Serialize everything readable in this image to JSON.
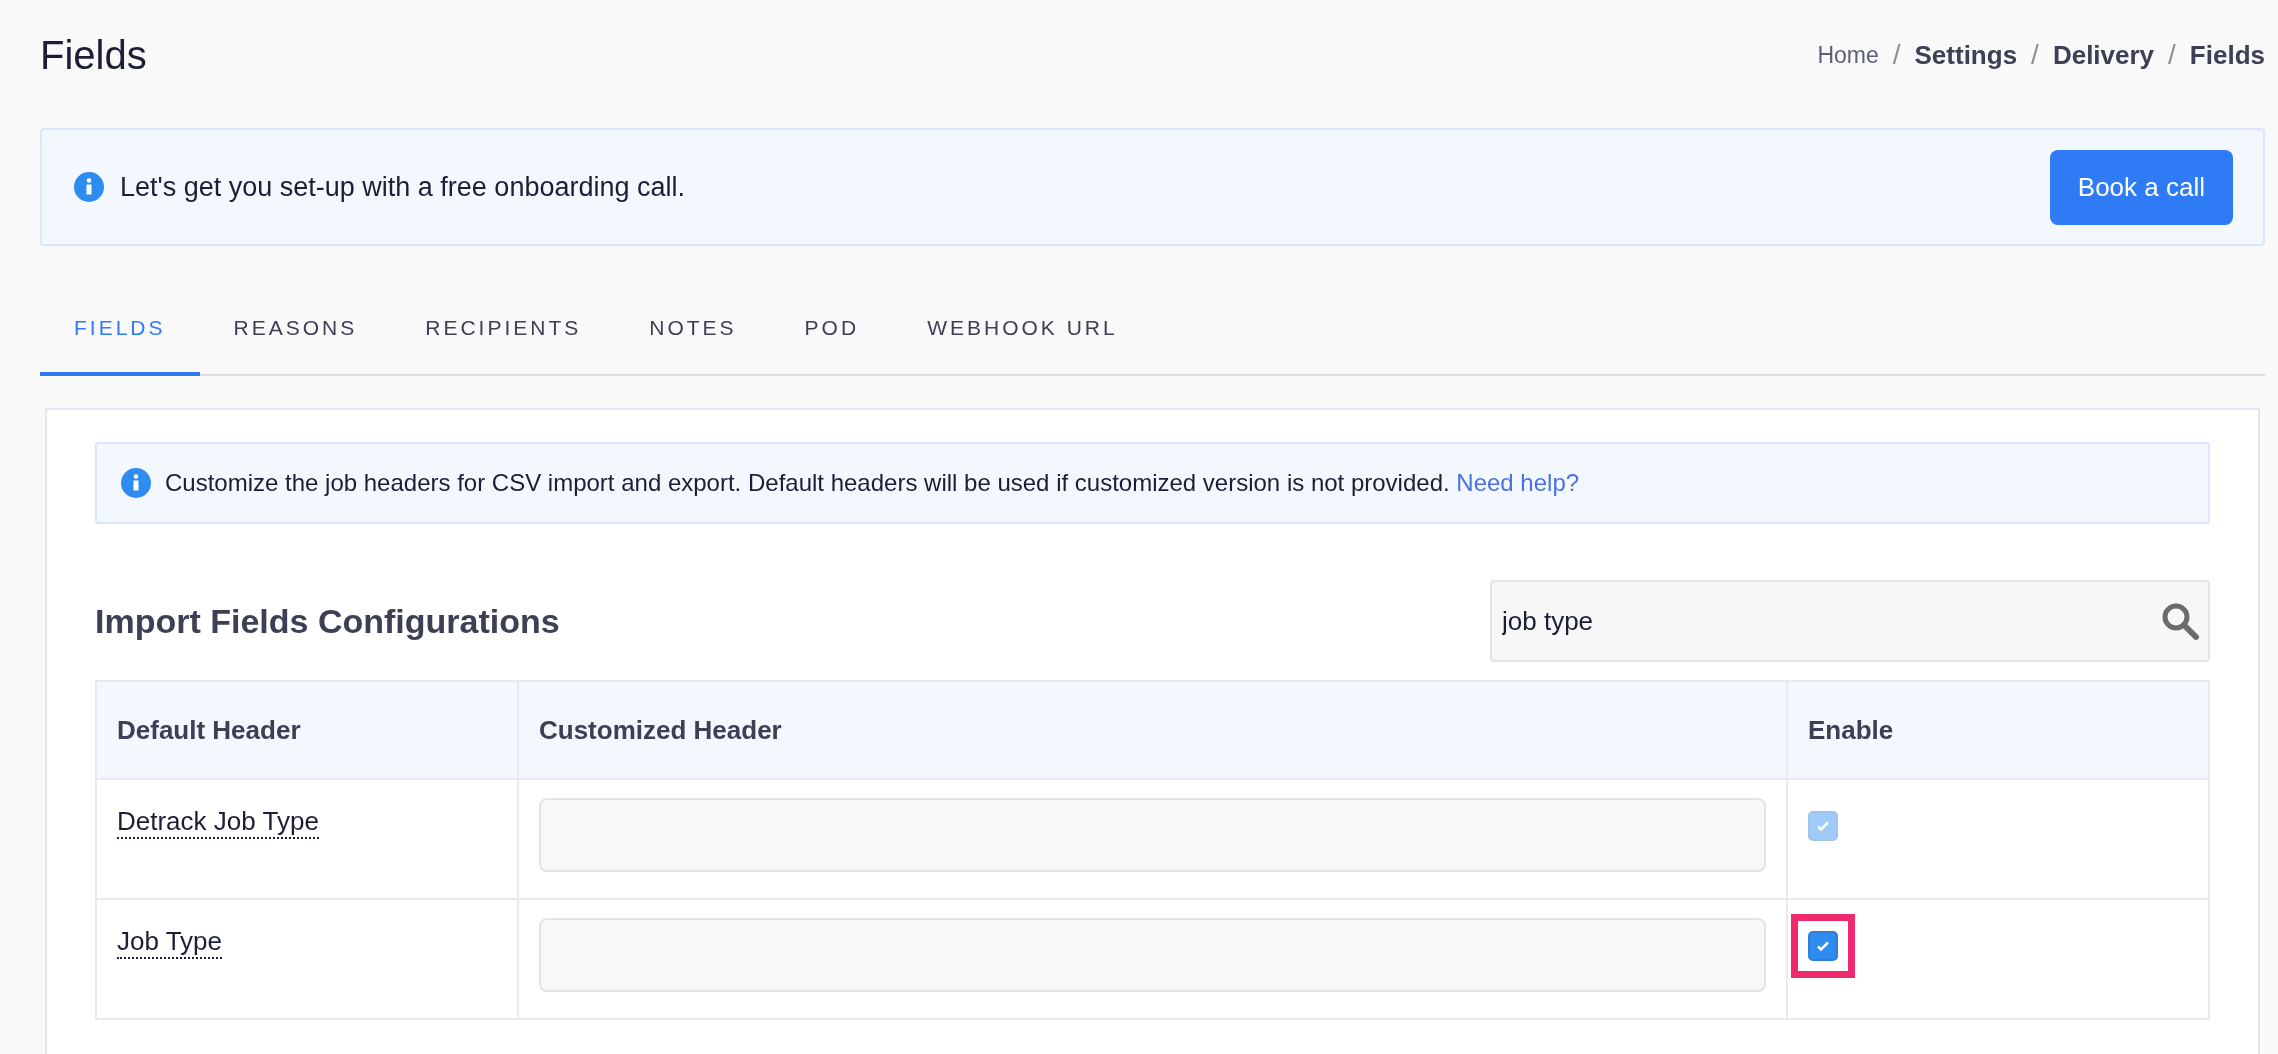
{
  "page": {
    "title": "Fields"
  },
  "breadcrumbs": [
    {
      "label": "Home",
      "current": false
    },
    {
      "label": "Settings",
      "current": true
    },
    {
      "label": "Delivery",
      "current": true
    },
    {
      "label": "Fields",
      "current": true
    }
  ],
  "breadcrumb_separator": "/",
  "banner": {
    "text": "Let's get you set-up with a free onboarding call.",
    "button": "Book a call"
  },
  "tabs": [
    {
      "label": "FIELDS",
      "selected": true
    },
    {
      "label": "REASONS",
      "selected": false
    },
    {
      "label": "RECIPIENTS",
      "selected": false
    },
    {
      "label": "NOTES",
      "selected": false
    },
    {
      "label": "POD",
      "selected": false
    },
    {
      "label": "WEBHOOK URL",
      "selected": false
    }
  ],
  "info": {
    "text": "Customize the job headers for CSV import and export. Default headers will be used if customized version is not provided.",
    "link": "Need help?"
  },
  "section": {
    "title": "Import Fields Configurations",
    "search": {
      "value": "job type"
    }
  },
  "table": {
    "columns": [
      "Default Header",
      "Customized Header",
      "Enable"
    ],
    "rows": [
      {
        "default_header": "Detrack Job Type",
        "enabled": true,
        "disabled": true,
        "highlighted": false
      },
      {
        "default_header": "Job Type",
        "enabled": true,
        "disabled": false,
        "highlighted": true
      }
    ]
  }
}
